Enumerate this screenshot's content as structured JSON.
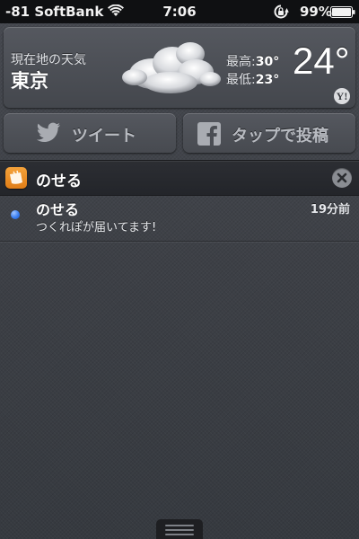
{
  "status_bar": {
    "carrier": "-81 SoftBank",
    "time": "7:06",
    "battery_percent": "99%",
    "wifi_icon": "wifi-icon",
    "lock_icon": "rotation-lock-icon",
    "battery_icon": "battery-icon"
  },
  "weather": {
    "location_label": "現在地の天気",
    "city": "東京",
    "high_label": "最高:",
    "high_value": "30°",
    "low_label": "最低:",
    "low_value": "23°",
    "temperature": "24°",
    "condition_icon": "cloud-icon",
    "provider_badge": "Y!"
  },
  "share": {
    "tweet_label": "ツイート",
    "post_label": "タップで投稿",
    "tweet_icon": "twitter-bird-icon",
    "post_icon": "facebook-icon"
  },
  "notifications": {
    "app_name": "のせる",
    "app_icon": "noseru-app-icon",
    "clear_icon": "close-icon",
    "items": [
      {
        "title": "のせる",
        "time": "19分前",
        "body": "つくれぽが届いてます!"
      }
    ]
  },
  "colors": {
    "unread_dot": "#3a7ef0",
    "app_icon": "#f0901f",
    "status_bar_bg": "#0f1012"
  }
}
